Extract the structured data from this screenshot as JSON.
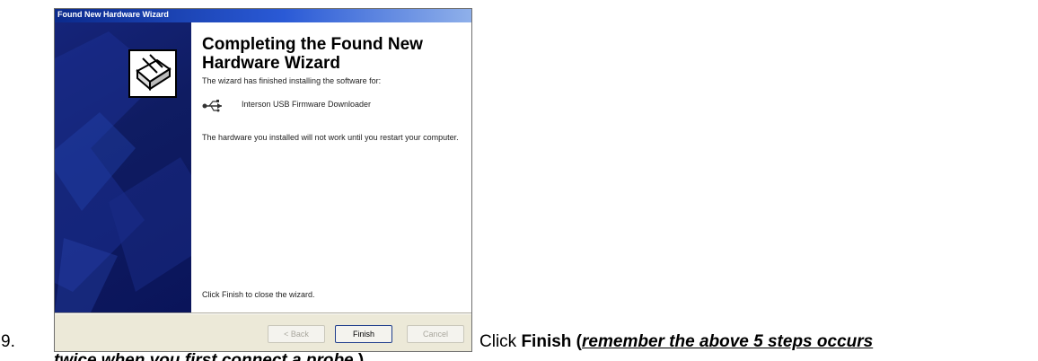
{
  "step": {
    "number": "9."
  },
  "wizard": {
    "title": "Found New Hardware Wizard",
    "heading": "Completing the Found New Hardware Wizard",
    "finished_text": "The wizard has finished installing the software for:",
    "device_name": "Interson USB Firmware Downloader",
    "restart_text": "The hardware you installed will not work until you restart your computer.",
    "close_text": "Click Finish to close the wizard.",
    "buttons": {
      "back": "< Back",
      "finish": "Finish",
      "cancel": "Cancel"
    },
    "icons": {
      "hardware": "hardware-device-icon",
      "usb": "usb-icon"
    },
    "colors": {
      "banner": "#0f1c62",
      "title_bar": "#0b2a8c",
      "face": "#ece9d8"
    }
  },
  "instruction": {
    "prefix": "Click ",
    "finish_word": "Finish",
    "paren_open": " (",
    "emphasis_line1": "remember the above 5 steps occurs",
    "emphasis_line2": "twice when you first connect a probe",
    "suffix": ".)"
  }
}
